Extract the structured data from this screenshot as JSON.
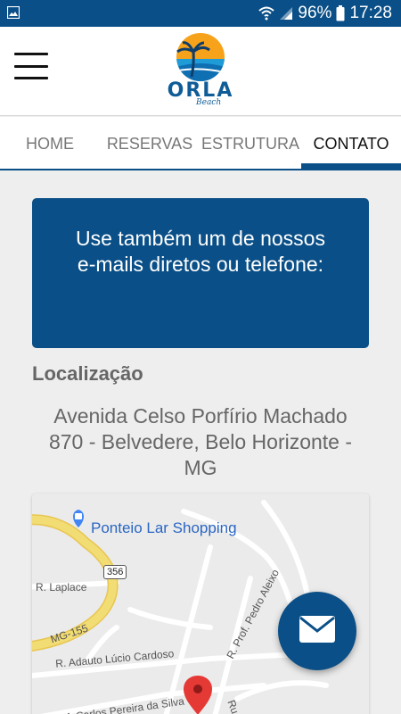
{
  "status_bar": {
    "battery": "96%",
    "time": "17:28"
  },
  "header": {
    "logo_text": "ORLA",
    "logo_subtext": "Beach"
  },
  "tabs": [
    {
      "label": "HOME",
      "active": false
    },
    {
      "label": "RESERVAS",
      "active": false
    },
    {
      "label": "ESTRUTURA",
      "active": false
    },
    {
      "label": "CONTATO",
      "active": true
    }
  ],
  "contact": {
    "card_line1": "Use também um de nossos",
    "card_line2": "e-mails diretos ou telefone:",
    "location_title": "Localização",
    "address_line1": "Avenida Celso Porfírio Machado",
    "address_line2": "870 - Belvedere, Belo Horizonte -",
    "address_line3": "MG"
  },
  "map": {
    "poi": "Ponteio Lar Shopping",
    "route_number": "356",
    "streets": {
      "laplace": "R. Laplace",
      "mg155": "MG-155",
      "adauto": "R. Adauto Lúcio Cardoso",
      "pedro": "R. Prof. Pedro Aleixo",
      "carlos": "Prof. Carlos Pereira da Silva",
      "r": "Ru"
    }
  },
  "colors": {
    "primary": "#0a4f87",
    "pin": "#e53935",
    "route": "#f2dc74"
  },
  "icons": {
    "fab": "envelope-icon",
    "menu": "hamburger-icon"
  }
}
